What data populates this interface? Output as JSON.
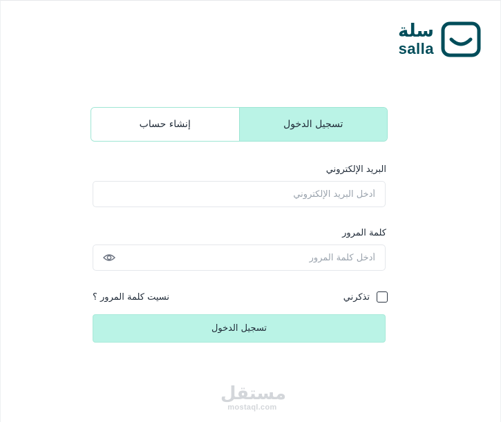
{
  "brand": {
    "name_ar": "سلة",
    "name_en": "salla",
    "logo_icon": "salla-bag-smile-icon",
    "color": "#004d5a"
  },
  "tabs": [
    {
      "label": "تسجيل الدخول",
      "active": true
    },
    {
      "label": "إنشاء حساب",
      "active": false
    }
  ],
  "email": {
    "label": "البريد الإلكتروني",
    "placeholder": "أدخل البريد الإلكتروني",
    "value": ""
  },
  "password": {
    "label": "كلمة المرور",
    "placeholder": "أدخل كلمة المرور",
    "value": "",
    "toggle_icon": "eye-icon"
  },
  "remember": {
    "label": "تذكرني",
    "checked": false
  },
  "forgot_label": "نسيت كلمة المرور ؟",
  "submit_label": "تسجيل الدخول",
  "watermark": {
    "ar": "مستقل",
    "en": "mostaql.com"
  },
  "colors": {
    "accent": "#baf3e6",
    "accent_border": "#9ee6d4",
    "text": "#1f2a37"
  }
}
